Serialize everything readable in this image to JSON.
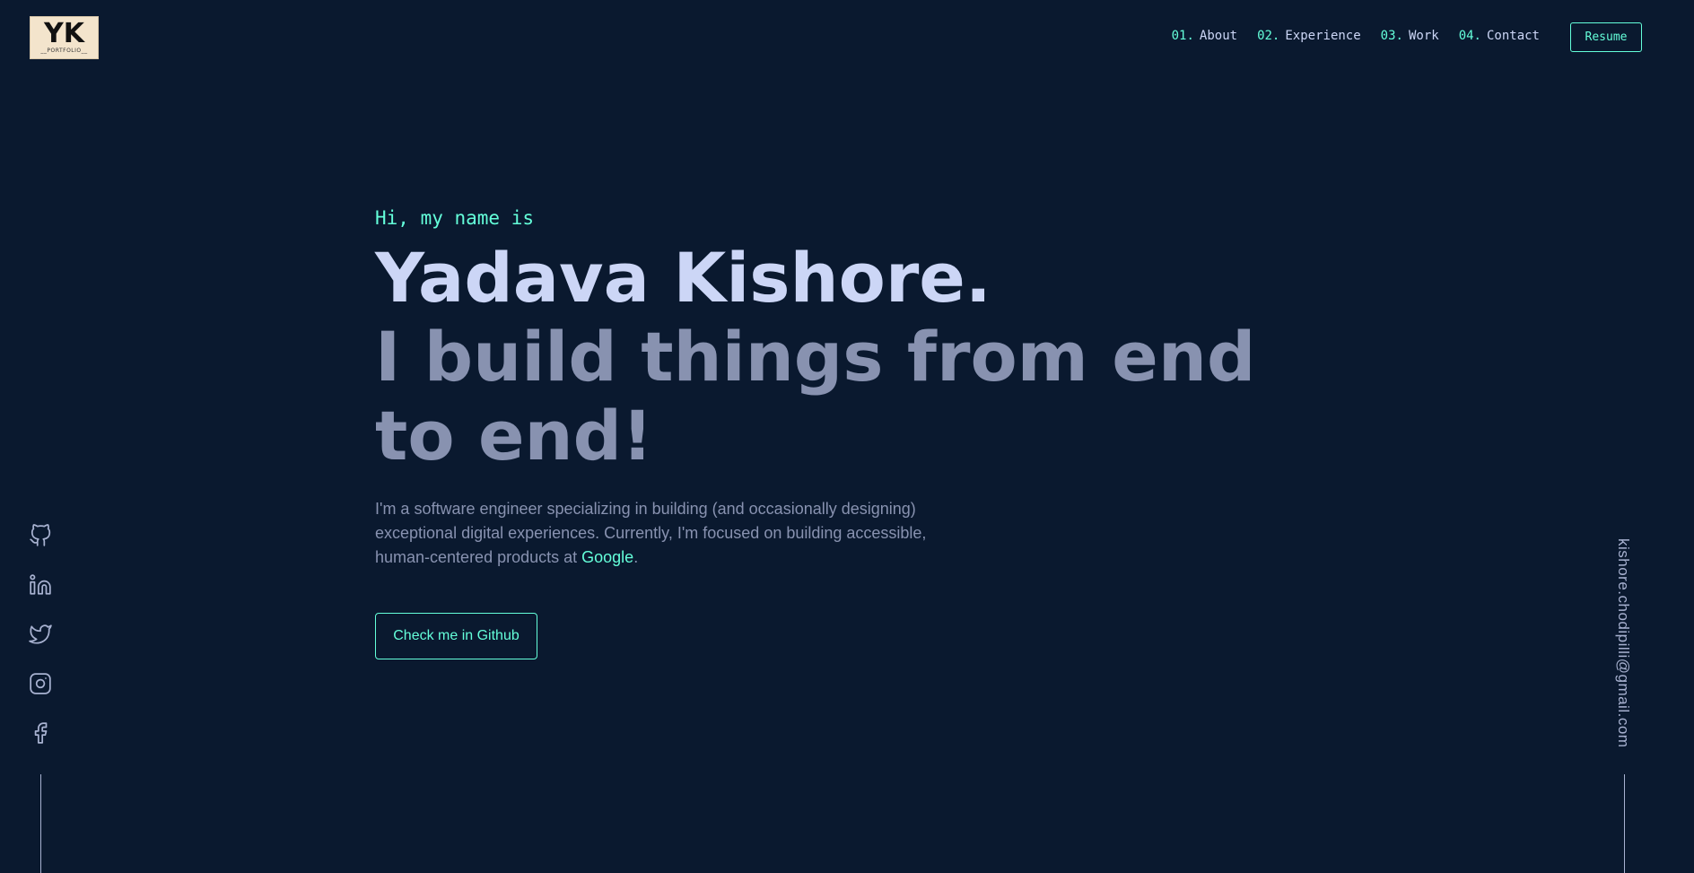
{
  "header": {
    "logo": {
      "main": "YK",
      "sub": "__PORTFOLIO__"
    },
    "nav": [
      {
        "num": "01.",
        "label": "About"
      },
      {
        "num": "02.",
        "label": "Experience"
      },
      {
        "num": "03.",
        "label": "Work"
      },
      {
        "num": "04.",
        "label": "Contact"
      }
    ],
    "resume_label": "Resume"
  },
  "hero": {
    "greeting": "Hi, my name is",
    "name": "Yadava Kishore.",
    "tagline": "I build things from end to end!",
    "intro_before": "I'm a software engineer specializing in building (and occasionally designing) exceptional digital experiences. Currently, I'm focused on building accessible, human-centered products at ",
    "intro_link": "Google",
    "intro_after": ".",
    "cta_label": "Check me in Github"
  },
  "social": {
    "icons": [
      "github-icon",
      "linkedin-icon",
      "twitter-icon",
      "instagram-icon",
      "facebook-icon"
    ]
  },
  "email": "kishore.chodipilli@gmail.com",
  "colors": {
    "background": "#0a192f",
    "accent": "#64ffda",
    "heading": "#ccd6f6",
    "text": "#8892b0"
  }
}
